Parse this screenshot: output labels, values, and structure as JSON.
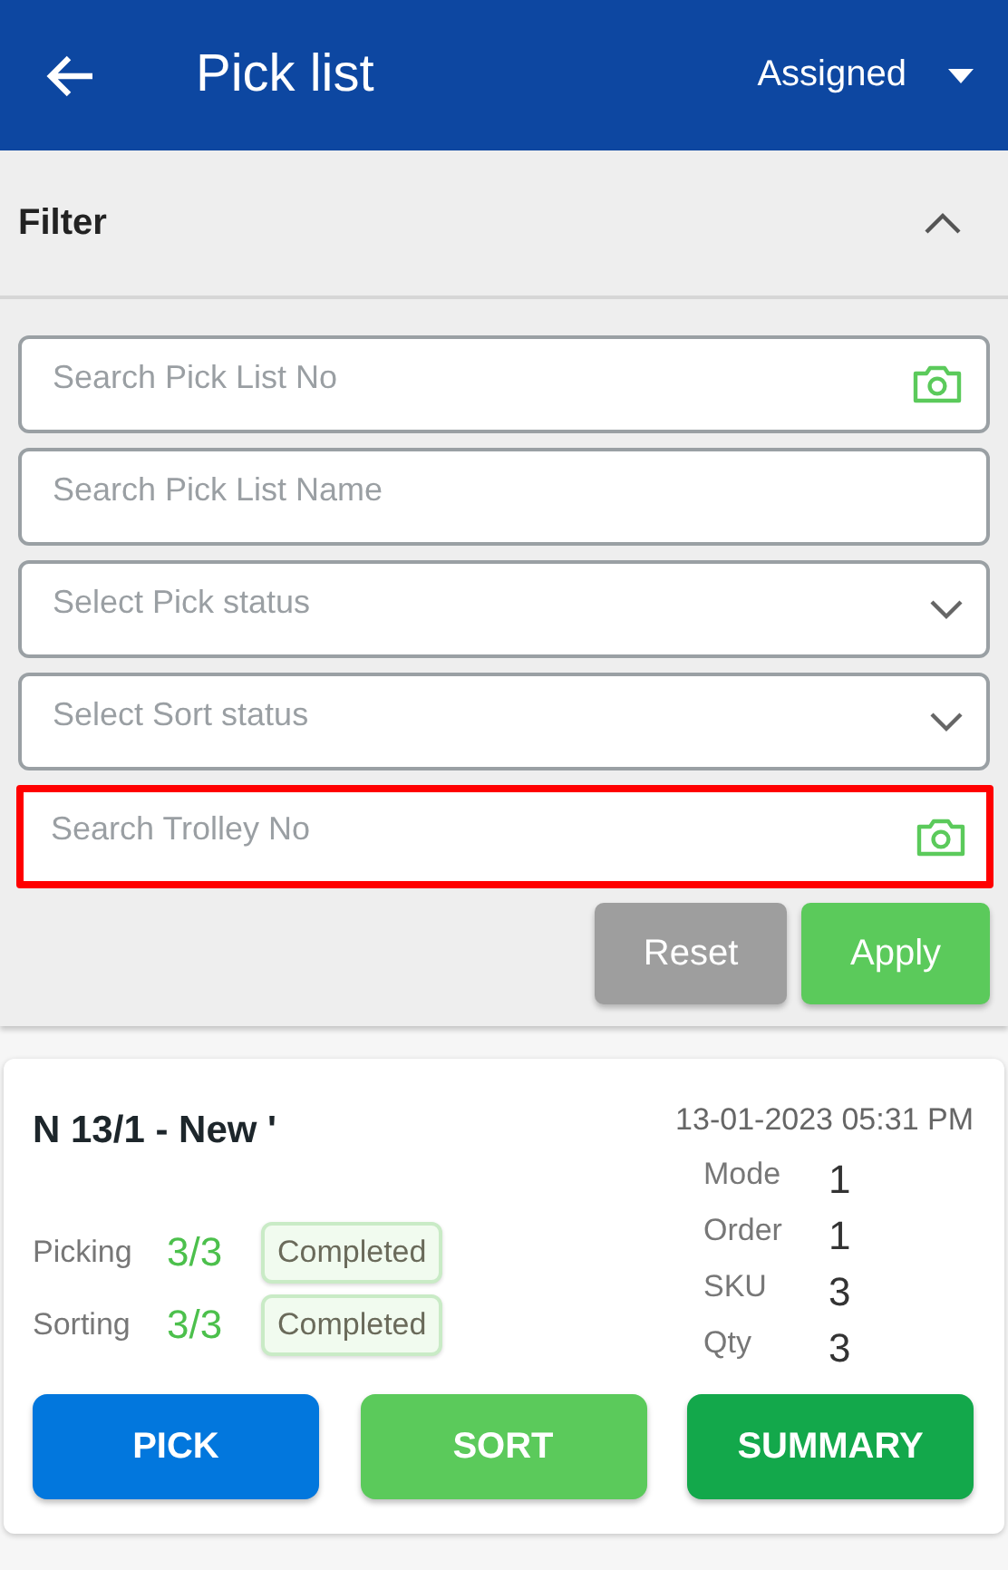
{
  "header": {
    "title": "Pick list",
    "status": "Assigned"
  },
  "filter": {
    "title": "Filter",
    "expanded": true,
    "fields": [
      {
        "kind": "scan",
        "placeholder": "Search Pick List No",
        "highlighted": false
      },
      {
        "kind": "text",
        "placeholder": "Search Pick List Name",
        "highlighted": false
      },
      {
        "kind": "select",
        "placeholder": "Select Pick status",
        "highlighted": false
      },
      {
        "kind": "select",
        "placeholder": "Select Sort status",
        "highlighted": false
      },
      {
        "kind": "scan",
        "placeholder": "Search Trolley No",
        "highlighted": true
      }
    ],
    "buttons": [
      {
        "label": "Reset",
        "color": "#9e9e9e"
      },
      {
        "label": "Apply",
        "color": "#5bca5b"
      }
    ]
  },
  "card": {
    "title": "N 13/1 - New '",
    "date": "13-01-2023 05:31 PM",
    "progress": [
      {
        "label": "Picking",
        "count": "3/3",
        "status": "Completed"
      },
      {
        "label": "Sorting",
        "count": "3/3",
        "status": "Completed"
      }
    ],
    "stats": [
      {
        "label": "Mode",
        "value": "1"
      },
      {
        "label": "Order",
        "value": "1"
      },
      {
        "label": "SKU",
        "value": "3"
      },
      {
        "label": "Qty",
        "value": "3"
      }
    ],
    "buttons": [
      {
        "label": "PICK",
        "color": "#0277dd"
      },
      {
        "label": "SORT",
        "color": "#5bca5b"
      },
      {
        "label": "SUMMARY",
        "color": "#13a84b"
      }
    ]
  }
}
